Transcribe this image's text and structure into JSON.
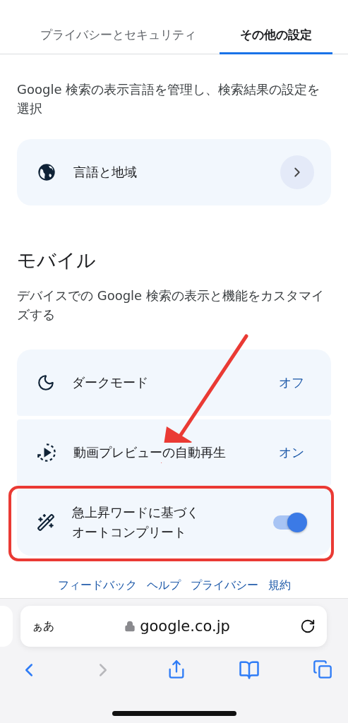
{
  "tabs": [
    {
      "label": "プライバシーとセキュリティ",
      "selected": false
    },
    {
      "label": "その他の設定",
      "selected": true
    }
  ],
  "language_section": {
    "description": "Google 検索の表示言語を管理し、検索結果の設定を選択",
    "item": {
      "label": "言語と地域"
    }
  },
  "mobile_section": {
    "title": "モバイル",
    "description": "デバイスでの Google 検索の表示と機能をカスタマイズする",
    "rows": [
      {
        "kind": "value",
        "label": "ダークモード",
        "value": "オフ",
        "highlighted": false
      },
      {
        "kind": "value",
        "label": "動画プレビューの自動再生",
        "value": "オン",
        "highlighted": false
      },
      {
        "kind": "toggle",
        "label": "急上昇ワードに基づくオートコンプリート",
        "on": true,
        "highlighted": true
      }
    ]
  },
  "footer_links": [
    "フィードバック",
    "ヘルプ",
    "プライバシー",
    "規約"
  ],
  "browser": {
    "text_size_button": "ぁあ",
    "url": "google.co.jp"
  }
}
